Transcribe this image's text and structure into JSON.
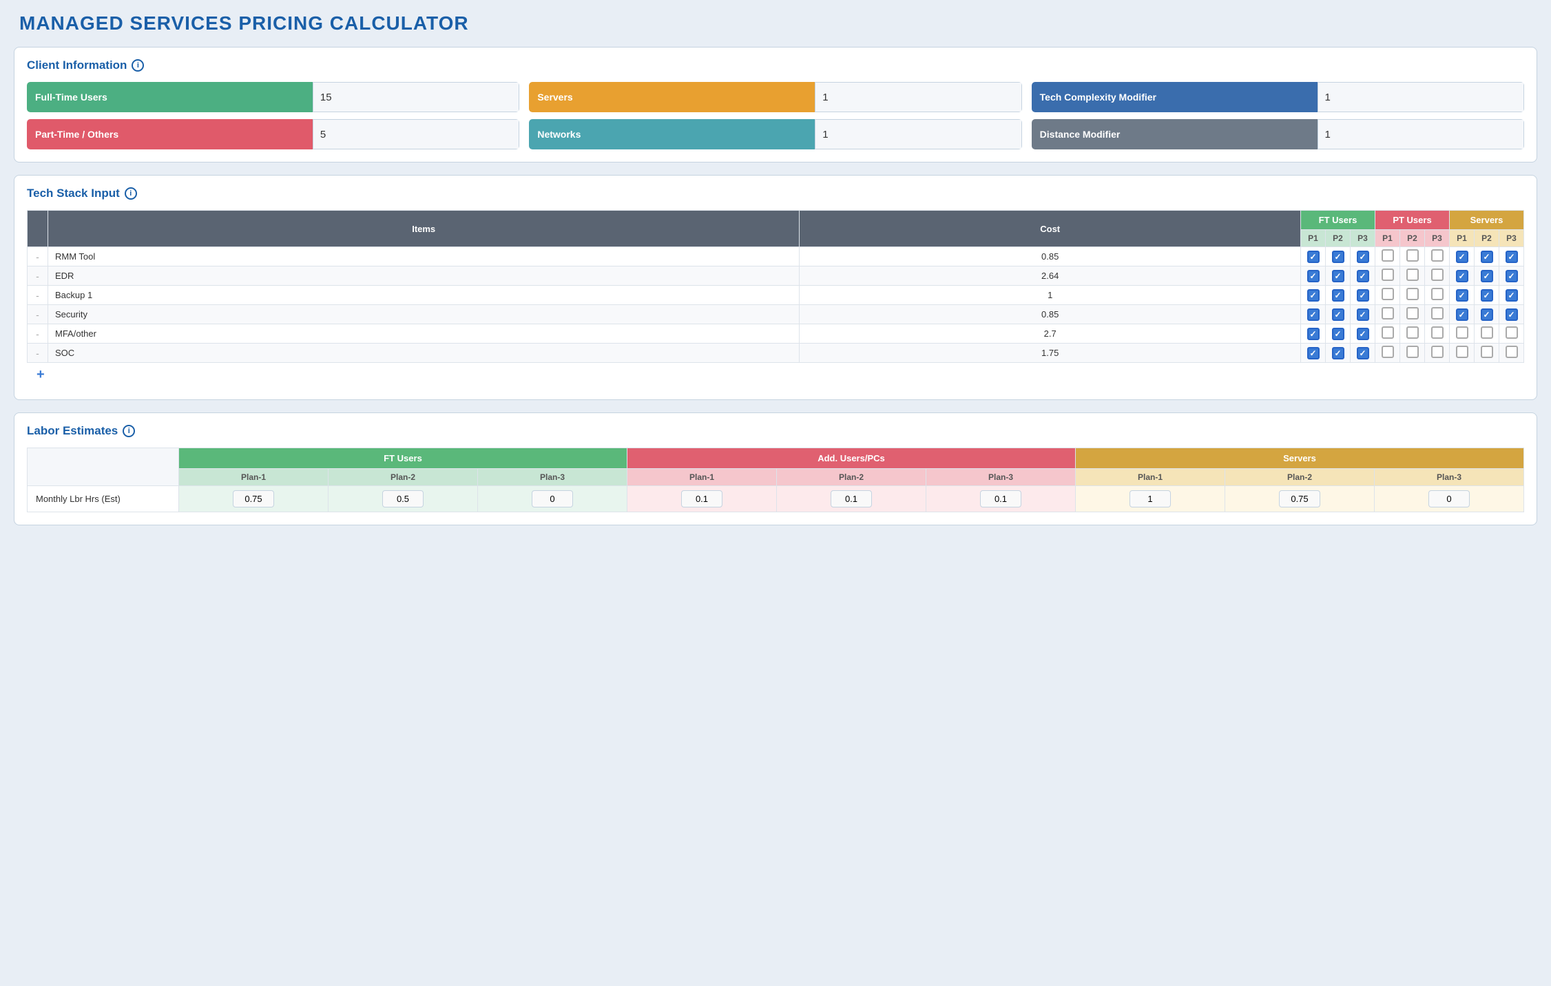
{
  "header": {
    "title": "MANAGED SERVICES PRICING CALCULATOR"
  },
  "client_information": {
    "section_title": "Client Information",
    "fields": [
      {
        "label": "Full-Time Users",
        "value": "15",
        "color": "color-green"
      },
      {
        "label": "Servers",
        "value": "1",
        "color": "color-orange"
      },
      {
        "label": "Tech Complexity Modifier",
        "value": "1",
        "color": "color-blue-dark"
      },
      {
        "label": "Part-Time / Others",
        "value": "5",
        "color": "color-red"
      },
      {
        "label": "Networks",
        "value": "1",
        "color": "color-teal"
      },
      {
        "label": "Distance Modifier",
        "value": "1",
        "color": "color-gray"
      }
    ]
  },
  "tech_stack": {
    "section_title": "Tech Stack Input",
    "col_groups": {
      "items": "Items",
      "cost": "Cost",
      "ft_users": "FT Users",
      "pt_users": "PT Users",
      "servers": "Servers"
    },
    "sub_cols": [
      "P1",
      "P2",
      "P3"
    ],
    "rows": [
      {
        "name": "RMM Tool",
        "cost": "0.85",
        "ft": [
          true,
          true,
          true
        ],
        "pt": [
          false,
          false,
          false
        ],
        "sv": [
          true,
          true,
          true
        ]
      },
      {
        "name": "EDR",
        "cost": "2.64",
        "ft": [
          true,
          true,
          true
        ],
        "pt": [
          false,
          false,
          false
        ],
        "sv": [
          true,
          true,
          true
        ]
      },
      {
        "name": "Backup 1",
        "cost": "1",
        "ft": [
          true,
          true,
          true
        ],
        "pt": [
          false,
          false,
          false
        ],
        "sv": [
          true,
          true,
          true
        ]
      },
      {
        "name": "Security",
        "cost": "0.85",
        "ft": [
          true,
          true,
          true
        ],
        "pt": [
          false,
          false,
          false
        ],
        "sv": [
          true,
          true,
          true
        ]
      },
      {
        "name": "MFA/other",
        "cost": "2.7",
        "ft": [
          true,
          true,
          true
        ],
        "pt": [
          false,
          false,
          false
        ],
        "sv": [
          false,
          false,
          false
        ]
      },
      {
        "name": "SOC",
        "cost": "1.75",
        "ft": [
          true,
          true,
          true
        ],
        "pt": [
          false,
          false,
          false
        ],
        "sv": [
          false,
          false,
          false
        ]
      }
    ],
    "add_label": "+"
  },
  "labor_estimates": {
    "section_title": "Labor Estimates",
    "col_groups": {
      "ft_users": "FT Users",
      "add_users": "Add. Users/PCs",
      "servers": "Servers"
    },
    "sub_cols": [
      "Plan-1",
      "Plan-2",
      "Plan-3"
    ],
    "rows": [
      {
        "label": "Monthly Lbr Hrs (Est)",
        "ft": [
          "0.75",
          "0.5",
          "0"
        ],
        "add": [
          "0.1",
          "0.1",
          "0.1"
        ],
        "sv": [
          "1",
          "0.75",
          "0"
        ]
      }
    ]
  }
}
